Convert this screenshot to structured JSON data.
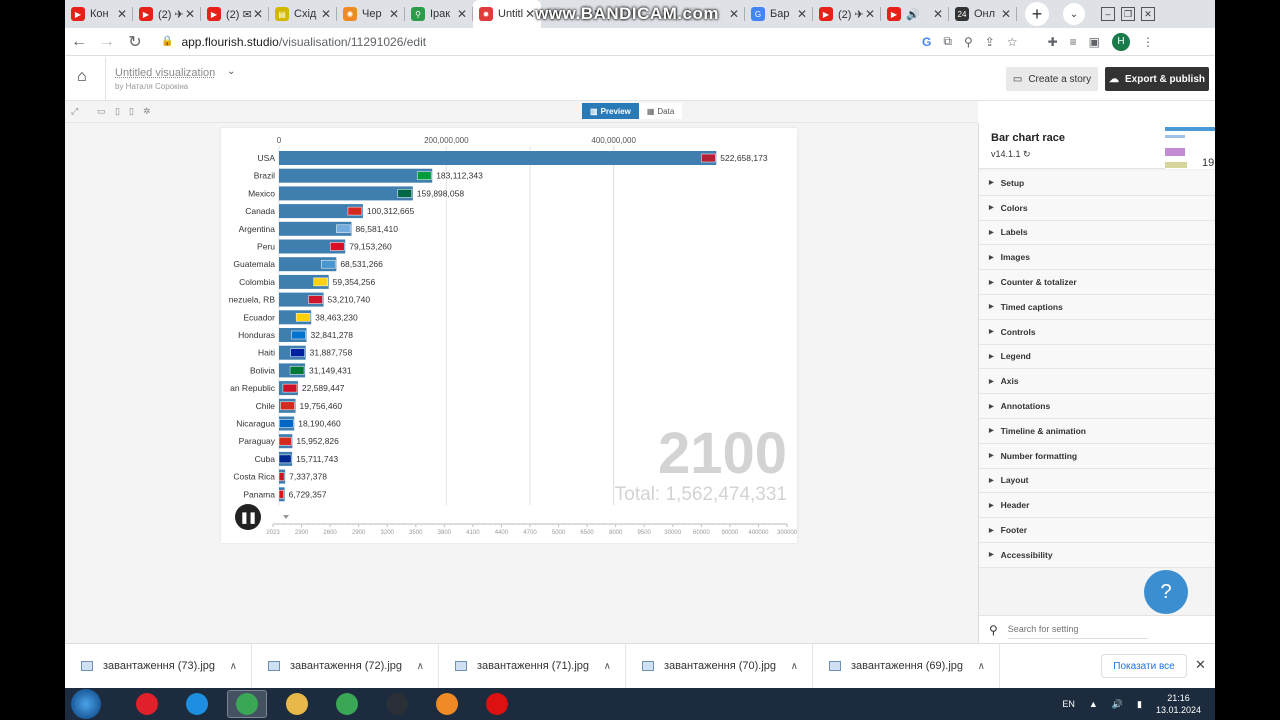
{
  "browser": {
    "tabs": [
      {
        "label": "Кон",
        "fav": "#e62117",
        "glyph": "▶"
      },
      {
        "label": "(2) ✈",
        "fav": "#e62117",
        "glyph": "▶"
      },
      {
        "label": "(2) ✉",
        "fav": "#e62117",
        "glyph": "▶"
      },
      {
        "label": "Схід",
        "fav": "#d4b800",
        "glyph": "▤"
      },
      {
        "label": "Чер",
        "fav": "#f08a24",
        "glyph": "✺"
      },
      {
        "label": "Ірак",
        "fav": "#2c9c4b",
        "glyph": "⚲"
      },
      {
        "label": "Untitl",
        "fav": "#e03a3a",
        "glyph": "✹",
        "active": true
      },
      {
        "label": "",
        "fav": "#cfd3d8",
        "glyph": ""
      },
      {
        "label": "",
        "fav": "#cfd3d8",
        "glyph": ""
      },
      {
        "label": "",
        "fav": "#cfd3d8",
        "glyph": ""
      },
      {
        "label": "Бар",
        "fav": "#4285f4",
        "glyph": "G"
      },
      {
        "label": "(2) ✈",
        "fav": "#e62117",
        "glyph": "▶"
      },
      {
        "label": "🔊",
        "fav": "#e62117",
        "glyph": "▶"
      },
      {
        "label": "Онл",
        "fav": "#333333",
        "glyph": "24"
      }
    ],
    "watermark": "www.BANDICAM.com",
    "url_host": "app.flourish.studio",
    "url_path": "/visualisation/11291026/edit",
    "profile_initial": "H"
  },
  "app": {
    "title": "Untitled visualization",
    "author": "by Наталя Сорокіна",
    "create_story": "Create a story",
    "export_publish": "Export & publish",
    "view_preview": "Preview",
    "view_data": "Data"
  },
  "chart_data": {
    "type": "bar",
    "orientation": "horizontal",
    "axis_ticks": [
      "0",
      "200,000,000",
      "400,000,000"
    ],
    "axis_tick_values": [
      0,
      200000000,
      400000000
    ],
    "xlim": [
      0,
      600000000
    ],
    "grid": true,
    "categories": [
      "USA",
      "Brazil",
      "Mexico",
      "Canada",
      "Argentina",
      "Peru",
      "Guatemala",
      "Colombia",
      "nezuela, RB",
      "Ecuador",
      "Honduras",
      "Haiti",
      "Bolivia",
      "an Republic",
      "Chile",
      "Nicaragua",
      "Paraguay",
      "Cuba",
      "Costa Rica",
      "Panama"
    ],
    "values": [
      522658173,
      183112343,
      159898058,
      100312665,
      86581410,
      79153260,
      68531266,
      59354256,
      53210740,
      38463230,
      32841278,
      31887758,
      31149431,
      22589447,
      19756460,
      18190460,
      15952826,
      15711743,
      7337378,
      6729357
    ],
    "value_labels": [
      "522,658,173",
      "183,112,343",
      "159,898,058",
      "100,312,665",
      "86,581,410",
      "79,153,260",
      "68,531,266",
      "59,354,256",
      "53,210,740",
      "38,463,230",
      "32,841,278",
      "31,887,758",
      "31,149,431",
      "22,589,447",
      "19,756,460",
      "18,190,460",
      "15,952,826",
      "15,711,743",
      "7,337,378",
      "6,729,357"
    ],
    "flag_colors": [
      "#b22234",
      "#009c3b",
      "#006847",
      "#d52b1e",
      "#74acdf",
      "#d91023",
      "#4997d0",
      "#fcd116",
      "#cf142b",
      "#ffd100",
      "#0073cf",
      "#00209f",
      "#007934",
      "#ce1126",
      "#d52b1e",
      "#0067c6",
      "#d52b1e",
      "#002a8f",
      "#ce1126",
      "#da121a"
    ],
    "bar_color": "#3f7fb0",
    "current_year": "2100",
    "total_label": "Total: 1,562,474,331",
    "timeline_ticks": [
      "2023",
      "2300",
      "2600",
      "2900",
      "3200",
      "3500",
      "3800",
      "4100",
      "4400",
      "4700",
      "5000",
      "6500",
      "8000",
      "9500",
      "30000",
      "60000",
      "90000",
      "400000",
      "300000"
    ]
  },
  "panel": {
    "title": "Bar chart race",
    "version": "v14.1.1",
    "thumb_year": "19",
    "sections": [
      "Setup",
      "Colors",
      "Labels",
      "Images",
      "Counter & totalizer",
      "Timed captions",
      "Controls",
      "Legend",
      "Axis",
      "Annotations",
      "Timeline & animation",
      "Number formatting",
      "Layout",
      "Header",
      "Footer",
      "Accessibility"
    ],
    "help": "?",
    "search_placeholder": "Search for setting"
  },
  "downloads": {
    "items": [
      "завантаження (73).jpg",
      "завантаження (72).jpg",
      "завантаження (71).jpg",
      "завантаження (70).jpg",
      "завантаження (69).jpg"
    ],
    "show_all": "Показати все"
  },
  "taskbar": {
    "lang": "EN",
    "time": "21:16",
    "date": "13.01.2024",
    "apps": [
      {
        "name": "opera",
        "color": "#e0202a"
      },
      {
        "name": "ie",
        "color": "#1e8fe0"
      },
      {
        "name": "chrome",
        "color": "#3aa757",
        "active": true
      },
      {
        "name": "explorer",
        "color": "#e8b94a"
      },
      {
        "name": "chrome2",
        "color": "#3aa757"
      },
      {
        "name": "mouse",
        "color": "#2a2f38"
      },
      {
        "name": "vlc",
        "color": "#f08a24"
      },
      {
        "name": "bandicam",
        "color": "#d11"
      }
    ]
  }
}
